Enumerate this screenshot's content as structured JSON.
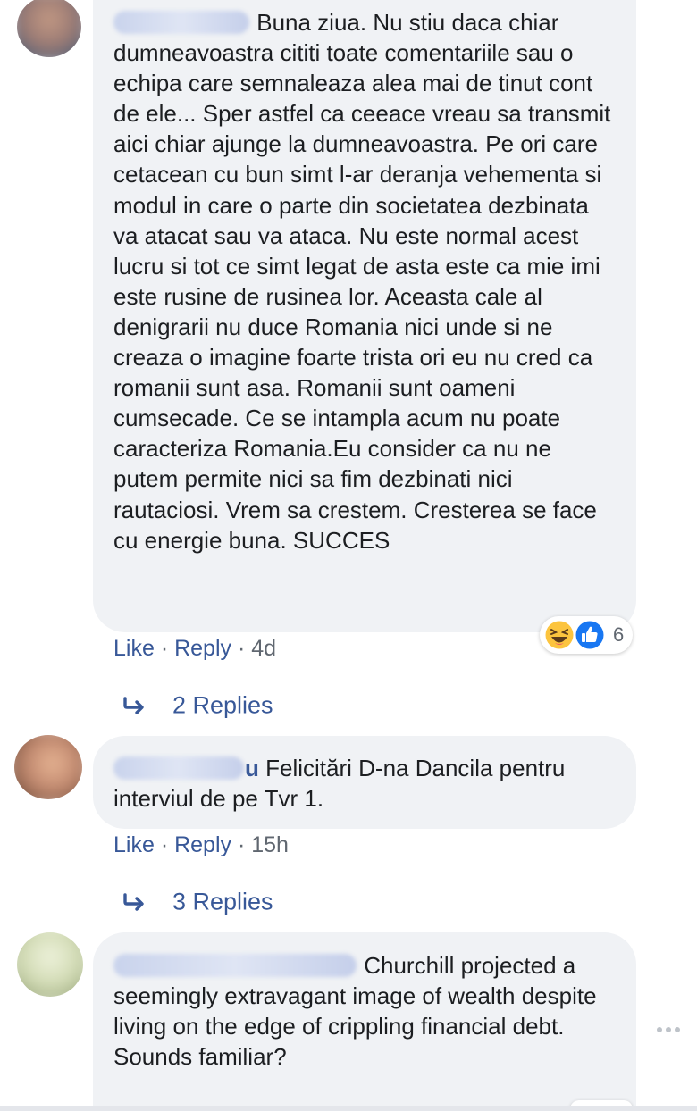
{
  "comments": [
    {
      "text": "Buna ziua. Nu stiu daca chiar dumneavoastra cititi toate comentariile sau o echipa care semnaleaza alea mai de tinut cont de ele... Sper astfel ca ceeace vreau sa transmit aici chiar ajunge la dumneavoastra. Pe ori care cetacean cu bun simt l-ar deranja vehementa si modul in care o parte din societatea dezbinata va atacat sau va ataca. Nu este normal acest lucru si tot ce simt legat de asta este ca mie imi este rusine de rusinea lor. Aceasta cale al denigrarii nu duce Romania nici unde si ne creaza o imagine foarte trista ori eu nu cred ca romanii sunt asa. Romanii sunt oameni cumsecade. Ce se intampla acum nu poate caracteriza Romania.Eu consider ca nu ne putem permite nici sa fim dezbinati nici rautaciosi. Vrem sa crestem. Cresterea se face cu energie buna. SUCCES",
      "name_tail": "",
      "like_label": "Like",
      "reply_label": "Reply",
      "time": "4d",
      "reaction_count": "6",
      "reaction_icons": [
        "haha-icon",
        "like-icon"
      ],
      "replies_label": "2 Replies"
    },
    {
      "text": "Felicitări D-na Dancila pentru interviul de pe Tvr 1.",
      "name_tail": "u",
      "like_label": "Like",
      "reply_label": "Reply",
      "time": "15h",
      "replies_label": "3 Replies"
    },
    {
      "text": "Churchill projected a seemingly extravagant image of wealth despite living on the edge of crippling financial debt.\nSounds familiar?",
      "name_tail": "",
      "more_icon": "more-options-icon"
    }
  ],
  "colors": {
    "link": "#385898",
    "meta": "#606770",
    "bubble": "#f0f2f5",
    "text": "#1c1e21"
  }
}
